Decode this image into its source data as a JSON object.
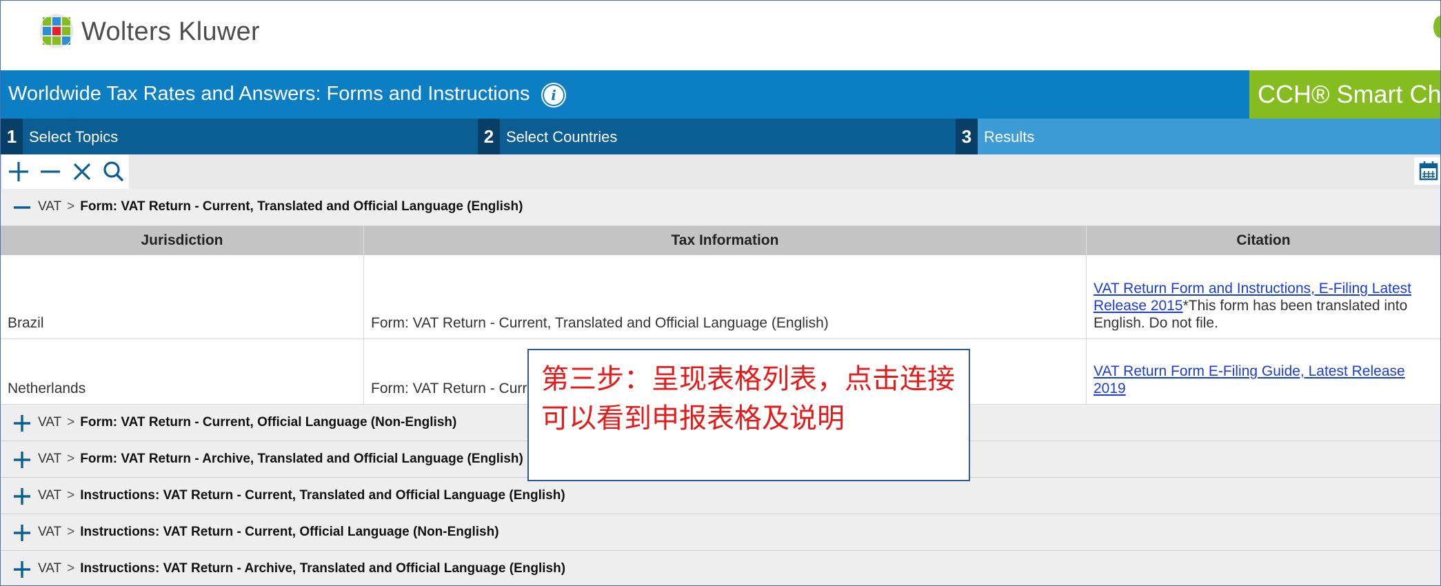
{
  "brand": {
    "logo_text": "Wolters Kluwer"
  },
  "header": {
    "title": "Worldwide Tax Rates and Answers: Forms and Instructions",
    "info_icon": "info-icon",
    "product_badge": "CCH® Smart Ch"
  },
  "steps": [
    {
      "number": "1",
      "label": "Select Topics"
    },
    {
      "number": "2",
      "label": "Select Countries"
    },
    {
      "number": "3",
      "label": "Results"
    }
  ],
  "toolbar": {
    "icons": [
      "plus-icon",
      "minus-icon",
      "close-icon",
      "search-icon",
      "calendar-icon"
    ]
  },
  "expanded_group": {
    "topic": "VAT",
    "separator": ">",
    "title": "Form: VAT Return - Current, Translated and Official Language (English)"
  },
  "table": {
    "headers": [
      "Jurisdiction",
      "Tax Information",
      "Citation"
    ],
    "rows": [
      {
        "jurisdiction": "Brazil",
        "tax_info": "Form: VAT Return - Current, Translated and Official Language (English)",
        "citation_link": "VAT Return Form and Instructions, E-Filing Latest Release 2015",
        "citation_note": "*This form has been translated into English. Do not file."
      },
      {
        "jurisdiction": "Netherlands",
        "tax_info": "Form: VAT Return - Current, Translated and Official Language (English)",
        "citation_link": "VAT Return Form E-Filing Guide, Latest Release 2019",
        "citation_note": ""
      }
    ]
  },
  "collapsed_groups": [
    {
      "topic": "VAT",
      "separator": ">",
      "title": "Form: VAT Return - Current, Official Language (Non-English)"
    },
    {
      "topic": "VAT",
      "separator": ">",
      "title": "Form: VAT Return - Archive, Translated and Official Language (English)"
    },
    {
      "topic": "VAT",
      "separator": ">",
      "title": "Instructions: VAT Return - Current, Translated and Official Language (English)"
    },
    {
      "topic": "VAT",
      "separator": ">",
      "title": "Instructions: VAT Return - Current, Official Language (Non-English)"
    },
    {
      "topic": "VAT",
      "separator": ">",
      "title": "Instructions: VAT Return - Archive, Translated and Official Language (English)"
    }
  ],
  "callout": {
    "text": "第三步：呈现表格列表，点击连接可以看到申报表格及说明"
  },
  "colors": {
    "title_bar": "#0b7ec4",
    "steps_bar": "#0b5e94",
    "active_step": "#3d9cd6",
    "brand_green": "#85bc20",
    "icon_blue": "#0b5e94",
    "link": "#1a3cd6",
    "callout_text": "#e31b1b"
  }
}
